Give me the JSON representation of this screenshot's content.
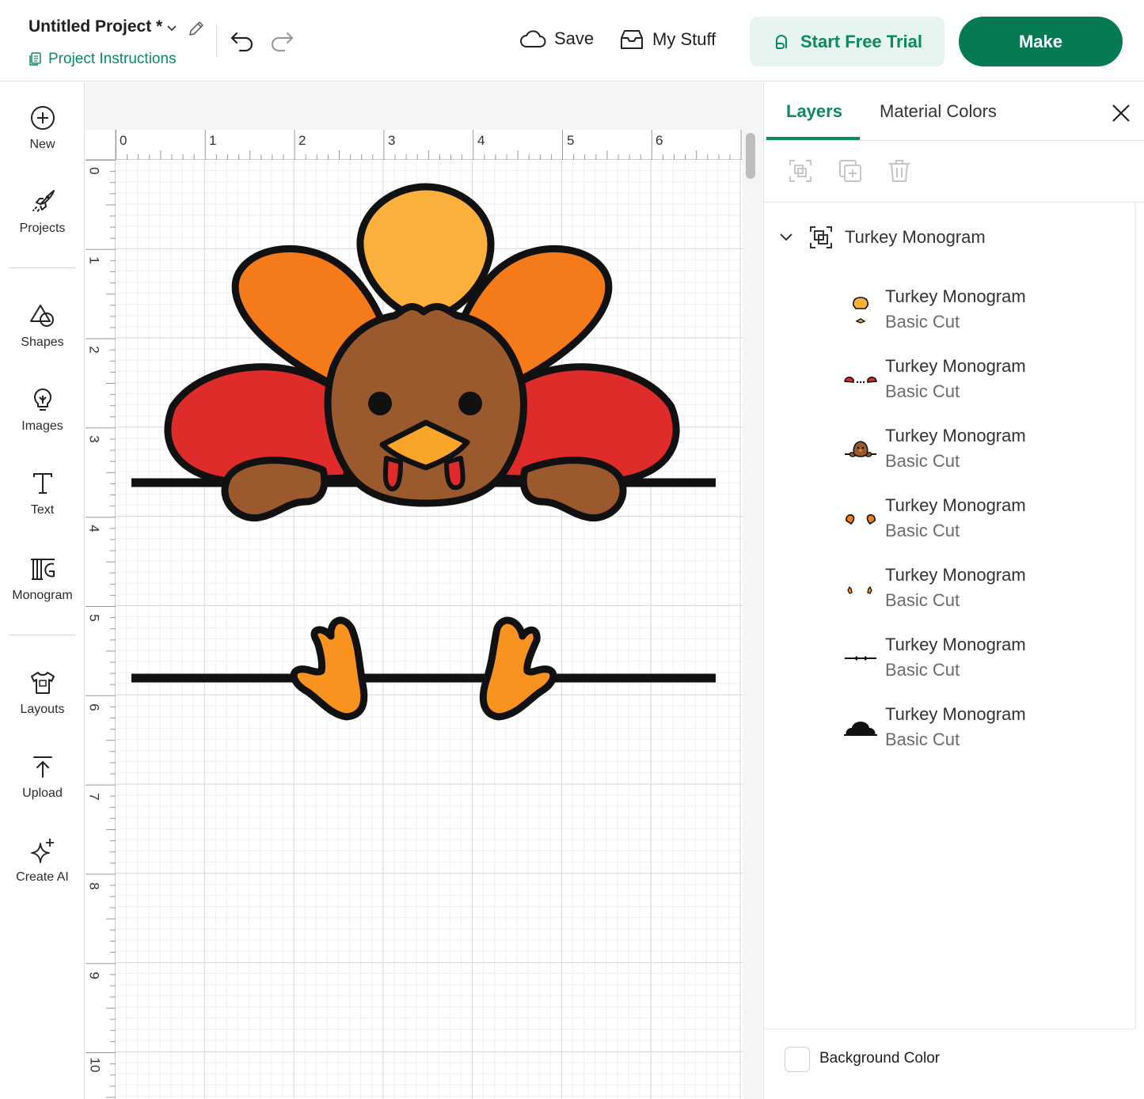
{
  "header": {
    "project_title": "Untitled Project *",
    "instructions_label": "Project Instructions",
    "save_label": "Save",
    "mystuff_label": "My Stuff",
    "trial_label": "Start Free Trial",
    "make_label": "Make"
  },
  "sidebar": {
    "items": [
      {
        "label": "New",
        "icon": "plus-circle-icon"
      },
      {
        "label": "Projects",
        "icon": "rocket-icon"
      },
      {
        "label": "Shapes",
        "icon": "shapes-icon"
      },
      {
        "label": "Images",
        "icon": "lightbulb-icon"
      },
      {
        "label": "Text",
        "icon": "text-icon"
      },
      {
        "label": "Monogram",
        "icon": "monogram-icon"
      },
      {
        "label": "Layouts",
        "icon": "tshirt-icon"
      },
      {
        "label": "Upload",
        "icon": "upload-icon"
      },
      {
        "label": "Create AI",
        "icon": "sparkle-icon"
      }
    ]
  },
  "canvas": {
    "ruler_top": [
      "0",
      "1",
      "2",
      "3",
      "4",
      "5",
      "6"
    ],
    "ruler_left": [
      "0",
      "1",
      "2",
      "3",
      "4",
      "5",
      "6",
      "7",
      "8",
      "9",
      "10"
    ]
  },
  "panel": {
    "tab_layers": "Layers",
    "tab_colors": "Material Colors",
    "group_name": "Turkey Monogram",
    "layers": [
      {
        "name": "Turkey Monogram",
        "type": "Basic Cut"
      },
      {
        "name": "Turkey Monogram",
        "type": "Basic Cut"
      },
      {
        "name": "Turkey Monogram",
        "type": "Basic Cut"
      },
      {
        "name": "Turkey Monogram",
        "type": "Basic Cut"
      },
      {
        "name": "Turkey Monogram",
        "type": "Basic Cut"
      },
      {
        "name": "Turkey Monogram",
        "type": "Basic Cut"
      },
      {
        "name": "Turkey Monogram",
        "type": "Basic Cut"
      }
    ],
    "background_color_label": "Background Color"
  },
  "colors": {
    "brand_green": "#067a50",
    "accent_green": "#0c8a5a",
    "feather_yellow": "#fbb03b",
    "feather_orange": "#f47a1a",
    "feather_red": "#e02b2b",
    "turkey_brown": "#9a5a2e",
    "beak": "#f9a52a"
  }
}
